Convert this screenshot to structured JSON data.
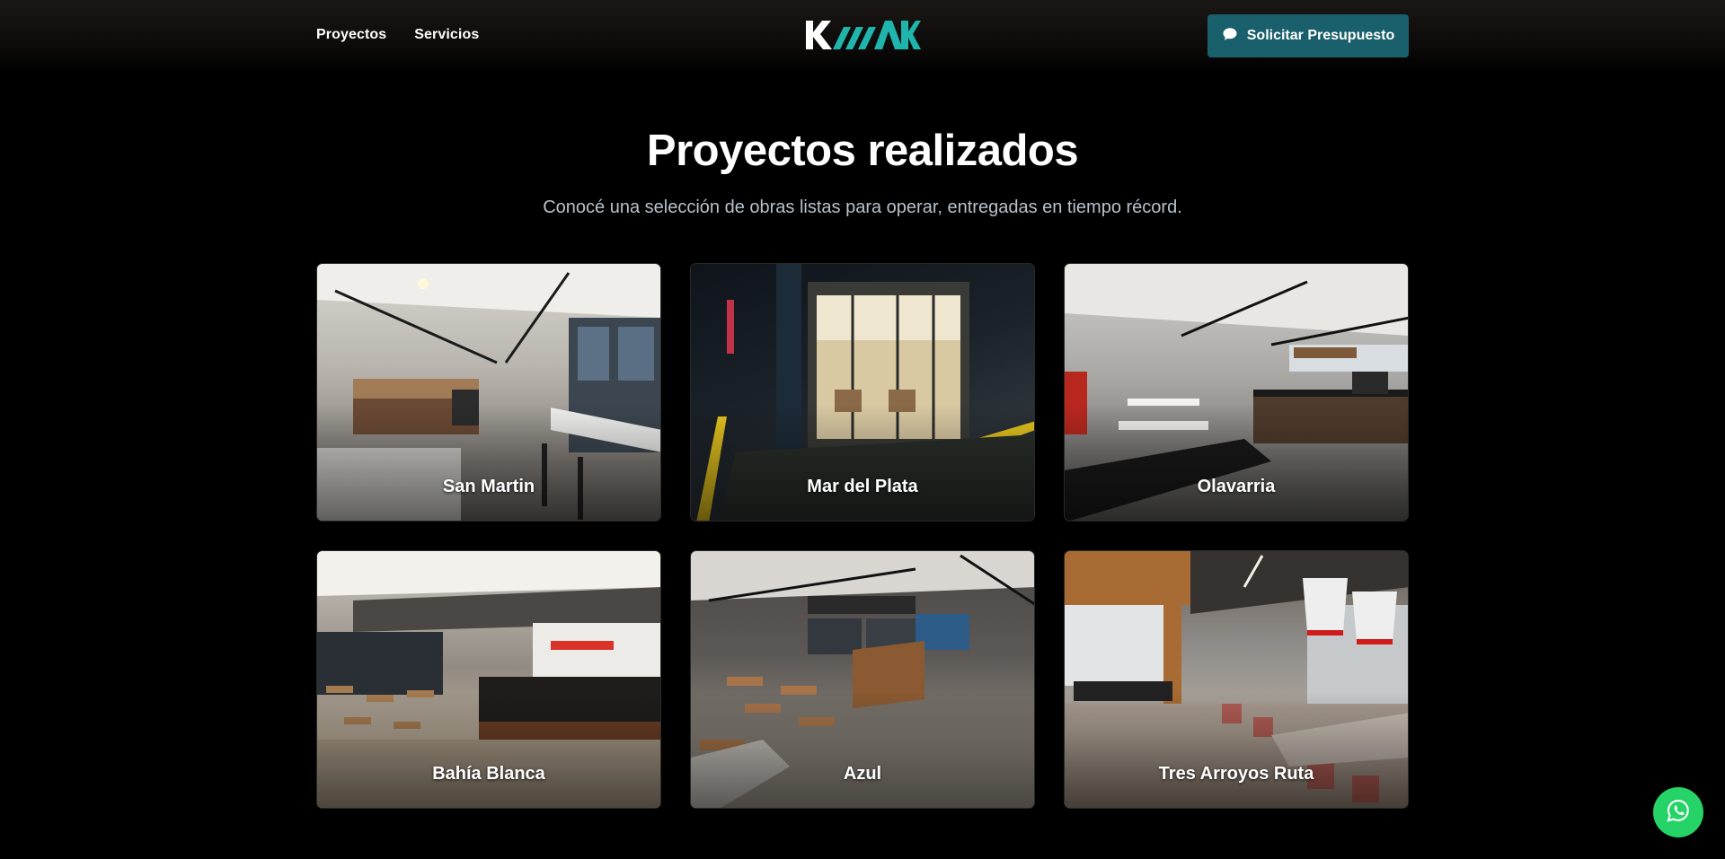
{
  "header": {
    "nav": [
      {
        "label": "Proyectos"
      },
      {
        "label": "Servicios"
      }
    ],
    "logo_text": "KAMAK",
    "cta_label": "Solicitar Presupuesto",
    "cta_icon": "chat-bubble-icon"
  },
  "hero": {
    "title": "Proyectos realizados",
    "subtitle": "Conocé una selección de obras listas para operar, entregadas en tiempo récord."
  },
  "projects": [
    {
      "name": "San Martin"
    },
    {
      "name": "Mar del Plata"
    },
    {
      "name": "Olavarria"
    },
    {
      "name": "Bahía Blanca"
    },
    {
      "name": "Azul"
    },
    {
      "name": "Tres Arroyos Ruta"
    }
  ],
  "floating": {
    "icon": "whatsapp-icon"
  },
  "colors": {
    "background": "#000000",
    "accent": "#1a5f6c",
    "logo_teal": "#1fb5ad",
    "whatsapp": "#25d366",
    "subtitle": "#b6c2cc"
  }
}
